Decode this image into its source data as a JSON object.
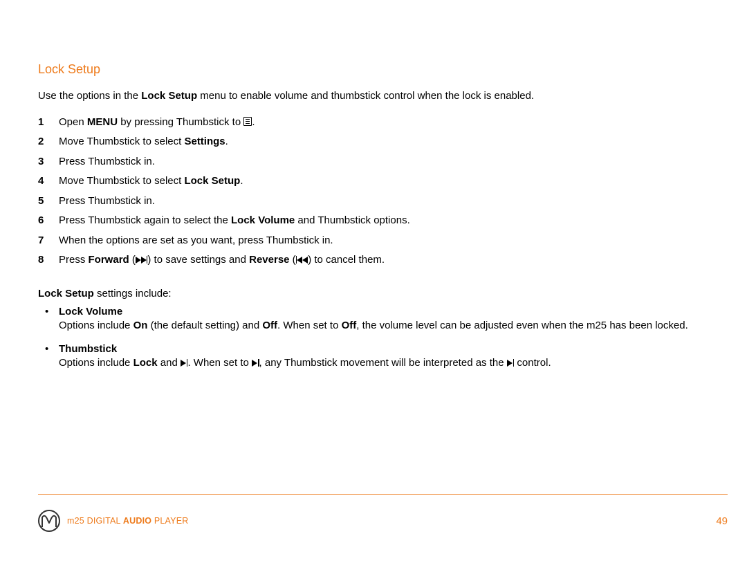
{
  "heading": "Lock Setup",
  "intro": {
    "pre": "Use the options in the ",
    "bold": "Lock Setup",
    "post": " menu to enable volume and thumbstick control when the lock is enabled."
  },
  "steps": [
    {
      "n": "1",
      "parts": [
        {
          "t": "Open "
        },
        {
          "t": "MENU",
          "b": true
        },
        {
          "t": " by pressing Thumbstick to "
        },
        {
          "sym": "menu"
        },
        {
          "t": "."
        }
      ]
    },
    {
      "n": "2",
      "parts": [
        {
          "t": "Move Thumbstick to select "
        },
        {
          "t": "Settings",
          "b": true
        },
        {
          "t": "."
        }
      ]
    },
    {
      "n": "3",
      "parts": [
        {
          "t": "Press Thumbstick in."
        }
      ]
    },
    {
      "n": "4",
      "parts": [
        {
          "t": "Move Thumbstick to select "
        },
        {
          "t": "Lock Setup",
          "b": true
        },
        {
          "t": "."
        }
      ]
    },
    {
      "n": "5",
      "parts": [
        {
          "t": "Press Thumbstick in."
        }
      ]
    },
    {
      "n": "6",
      "parts": [
        {
          "t": "Press Thumbstick again to select the "
        },
        {
          "t": "Lock Volume",
          "b": true
        },
        {
          "t": " and Thumbstick options."
        }
      ]
    },
    {
      "n": "7",
      "parts": [
        {
          "t": "When the options are set as you want, press Thumbstick in."
        }
      ]
    },
    {
      "n": "8",
      "parts": [
        {
          "t": "Press "
        },
        {
          "t": "Forward",
          "b": true
        },
        {
          "t": " ("
        },
        {
          "sym": "ffwd"
        },
        {
          "t": ") to save settings and "
        },
        {
          "t": "Reverse",
          "b": true
        },
        {
          "t": " ("
        },
        {
          "sym": "rew"
        },
        {
          "t": ") to cancel them."
        }
      ]
    }
  ],
  "settings_intro": {
    "bold": "Lock Setup",
    "rest": " settings include:"
  },
  "options": [
    {
      "title": "Lock Volume",
      "parts": [
        {
          "t": "Options include "
        },
        {
          "t": "On",
          "b": true
        },
        {
          "t": " (the default setting) and "
        },
        {
          "t": "Off",
          "b": true
        },
        {
          "t": ". When set to "
        },
        {
          "t": "Off",
          "b": true
        },
        {
          "t": ", the volume level can be adjusted even when the m25 has been locked."
        }
      ]
    },
    {
      "title": "Thumbstick",
      "parts": [
        {
          "t": "Options include "
        },
        {
          "t": "Lock",
          "b": true
        },
        {
          "t": " and "
        },
        {
          "sym": "playpause"
        },
        {
          "t": ". When set to "
        },
        {
          "sym": "playpause"
        },
        {
          "t": ", any Thumbstick movement will be interpreted as the "
        },
        {
          "sym": "playpause"
        },
        {
          "t": " control."
        }
      ]
    }
  ],
  "footer": {
    "text_pre": "m25 DIGITAL ",
    "text_bold": "AUDIO",
    "text_post": " PLAYER",
    "page": "49"
  }
}
